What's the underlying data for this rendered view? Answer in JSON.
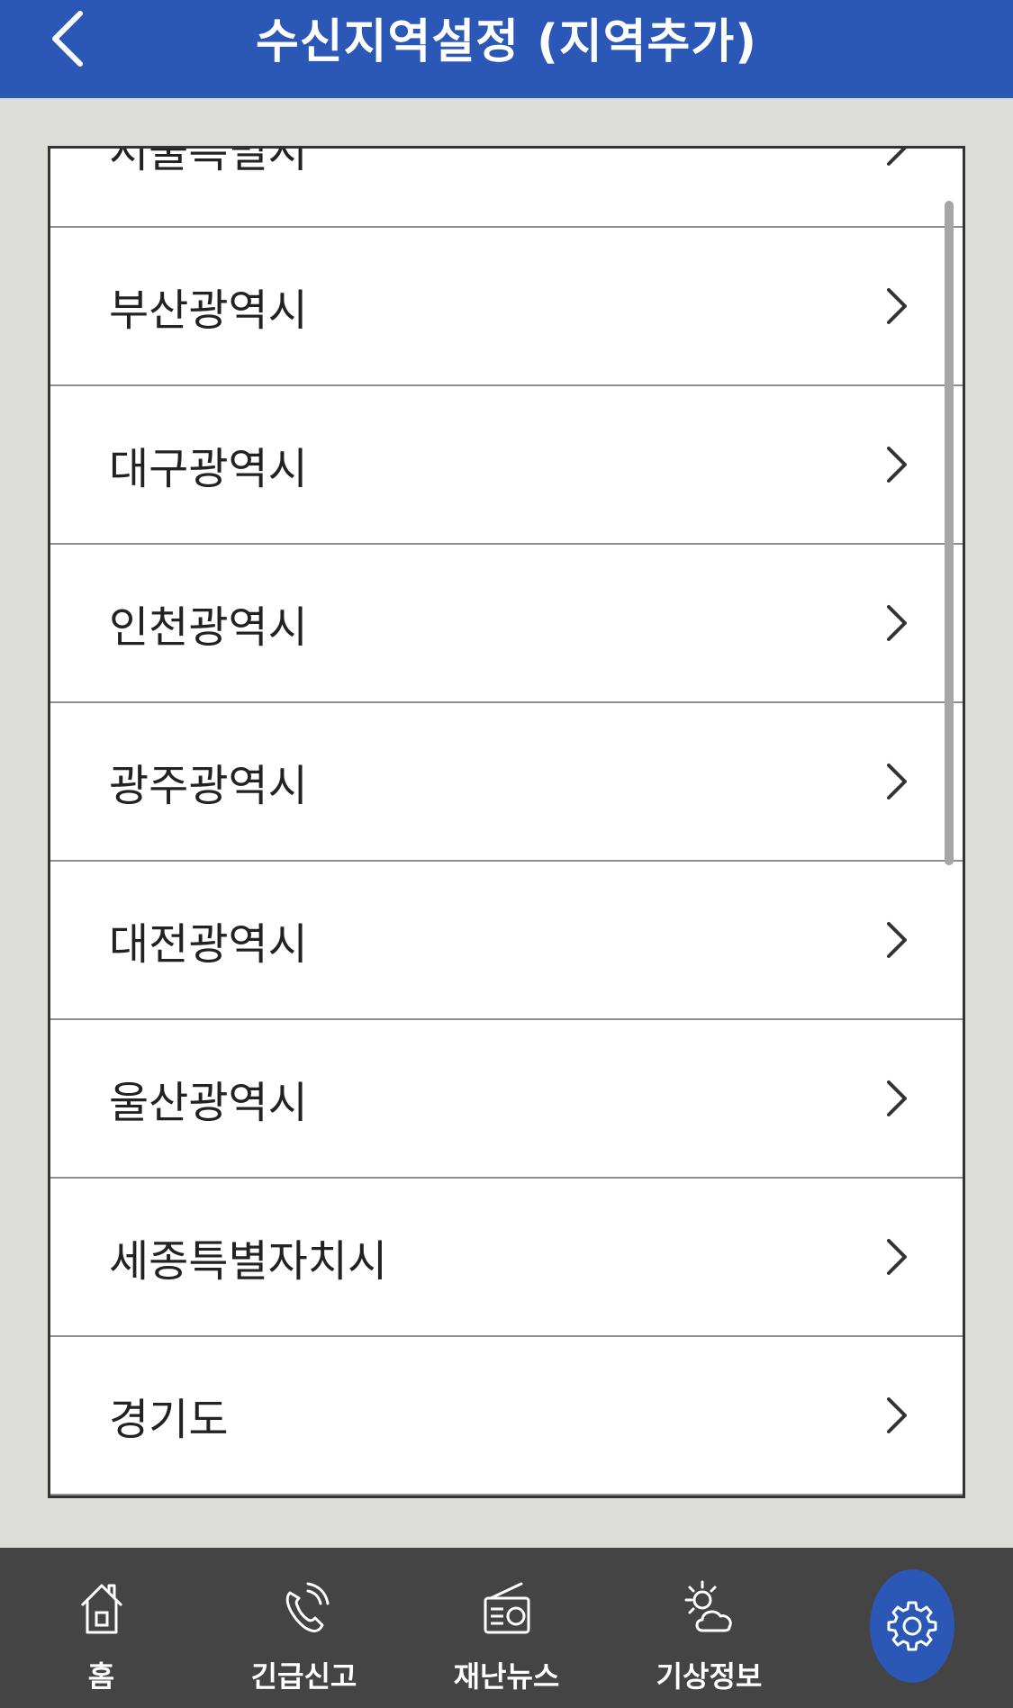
{
  "header": {
    "title": "수신지역설정 (지역추가)",
    "back_icon": "chevron-left-icon",
    "color": "#2b57b7"
  },
  "regions": [
    "서울특별시",
    "부산광역시",
    "대구광역시",
    "인천광역시",
    "광주광역시",
    "대전광역시",
    "울산광역시",
    "세종특별자치시",
    "경기도"
  ],
  "nav": {
    "items": [
      {
        "label": "홈",
        "icon": "home-icon"
      },
      {
        "label": "긴급신고",
        "icon": "phone-icon"
      },
      {
        "label": "재난뉴스",
        "icon": "radio-icon"
      },
      {
        "label": "기상정보",
        "icon": "weather-icon"
      }
    ],
    "settings_icon": "gear-icon",
    "background": "#444444"
  }
}
